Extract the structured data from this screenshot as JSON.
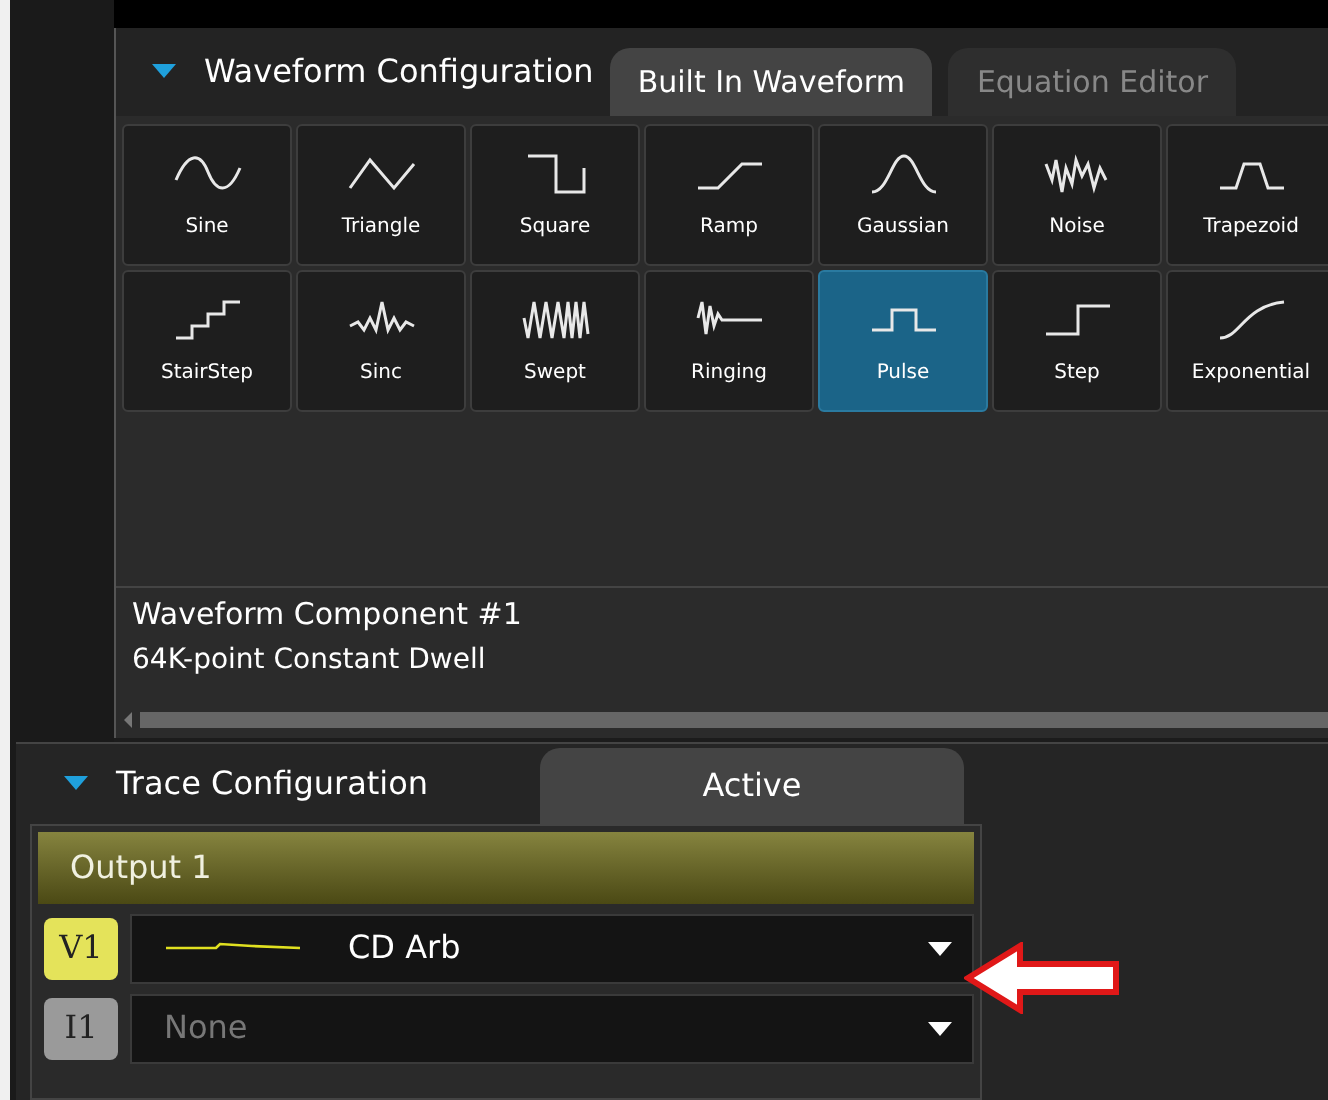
{
  "waveform_configuration": {
    "title": "Waveform Configuration",
    "expanded": true,
    "tabs": [
      {
        "label": "Built In Waveform",
        "selected": true
      },
      {
        "label": "Equation Editor",
        "selected": false
      }
    ],
    "waveforms": [
      {
        "label": "Sine",
        "selected": false
      },
      {
        "label": "Triangle",
        "selected": false
      },
      {
        "label": "Square",
        "selected": false
      },
      {
        "label": "Ramp",
        "selected": false
      },
      {
        "label": "Gaussian",
        "selected": false
      },
      {
        "label": "Noise",
        "selected": false
      },
      {
        "label": "Trapezoid",
        "selected": false
      },
      {
        "label": "StairStep",
        "selected": false
      },
      {
        "label": "Sinc",
        "selected": false
      },
      {
        "label": "Swept",
        "selected": false
      },
      {
        "label": "Ringing",
        "selected": false
      },
      {
        "label": "Pulse",
        "selected": true
      },
      {
        "label": "Step",
        "selected": false
      },
      {
        "label": "Exponential",
        "selected": false
      }
    ],
    "component_title": "Waveform Component #1",
    "component_detail": "64K-point Constant Dwell"
  },
  "trace_configuration": {
    "title": "Trace Configuration",
    "expanded": true,
    "tabs": [
      {
        "label": "Active",
        "selected": true
      }
    ],
    "output": {
      "title": "Output 1",
      "channels": [
        {
          "badge": "V1",
          "color": "#e4e35a",
          "value": "CD Arb",
          "active": true
        },
        {
          "badge": "I1",
          "color": "#9a9a9a",
          "value": "None",
          "active": false
        }
      ]
    }
  }
}
